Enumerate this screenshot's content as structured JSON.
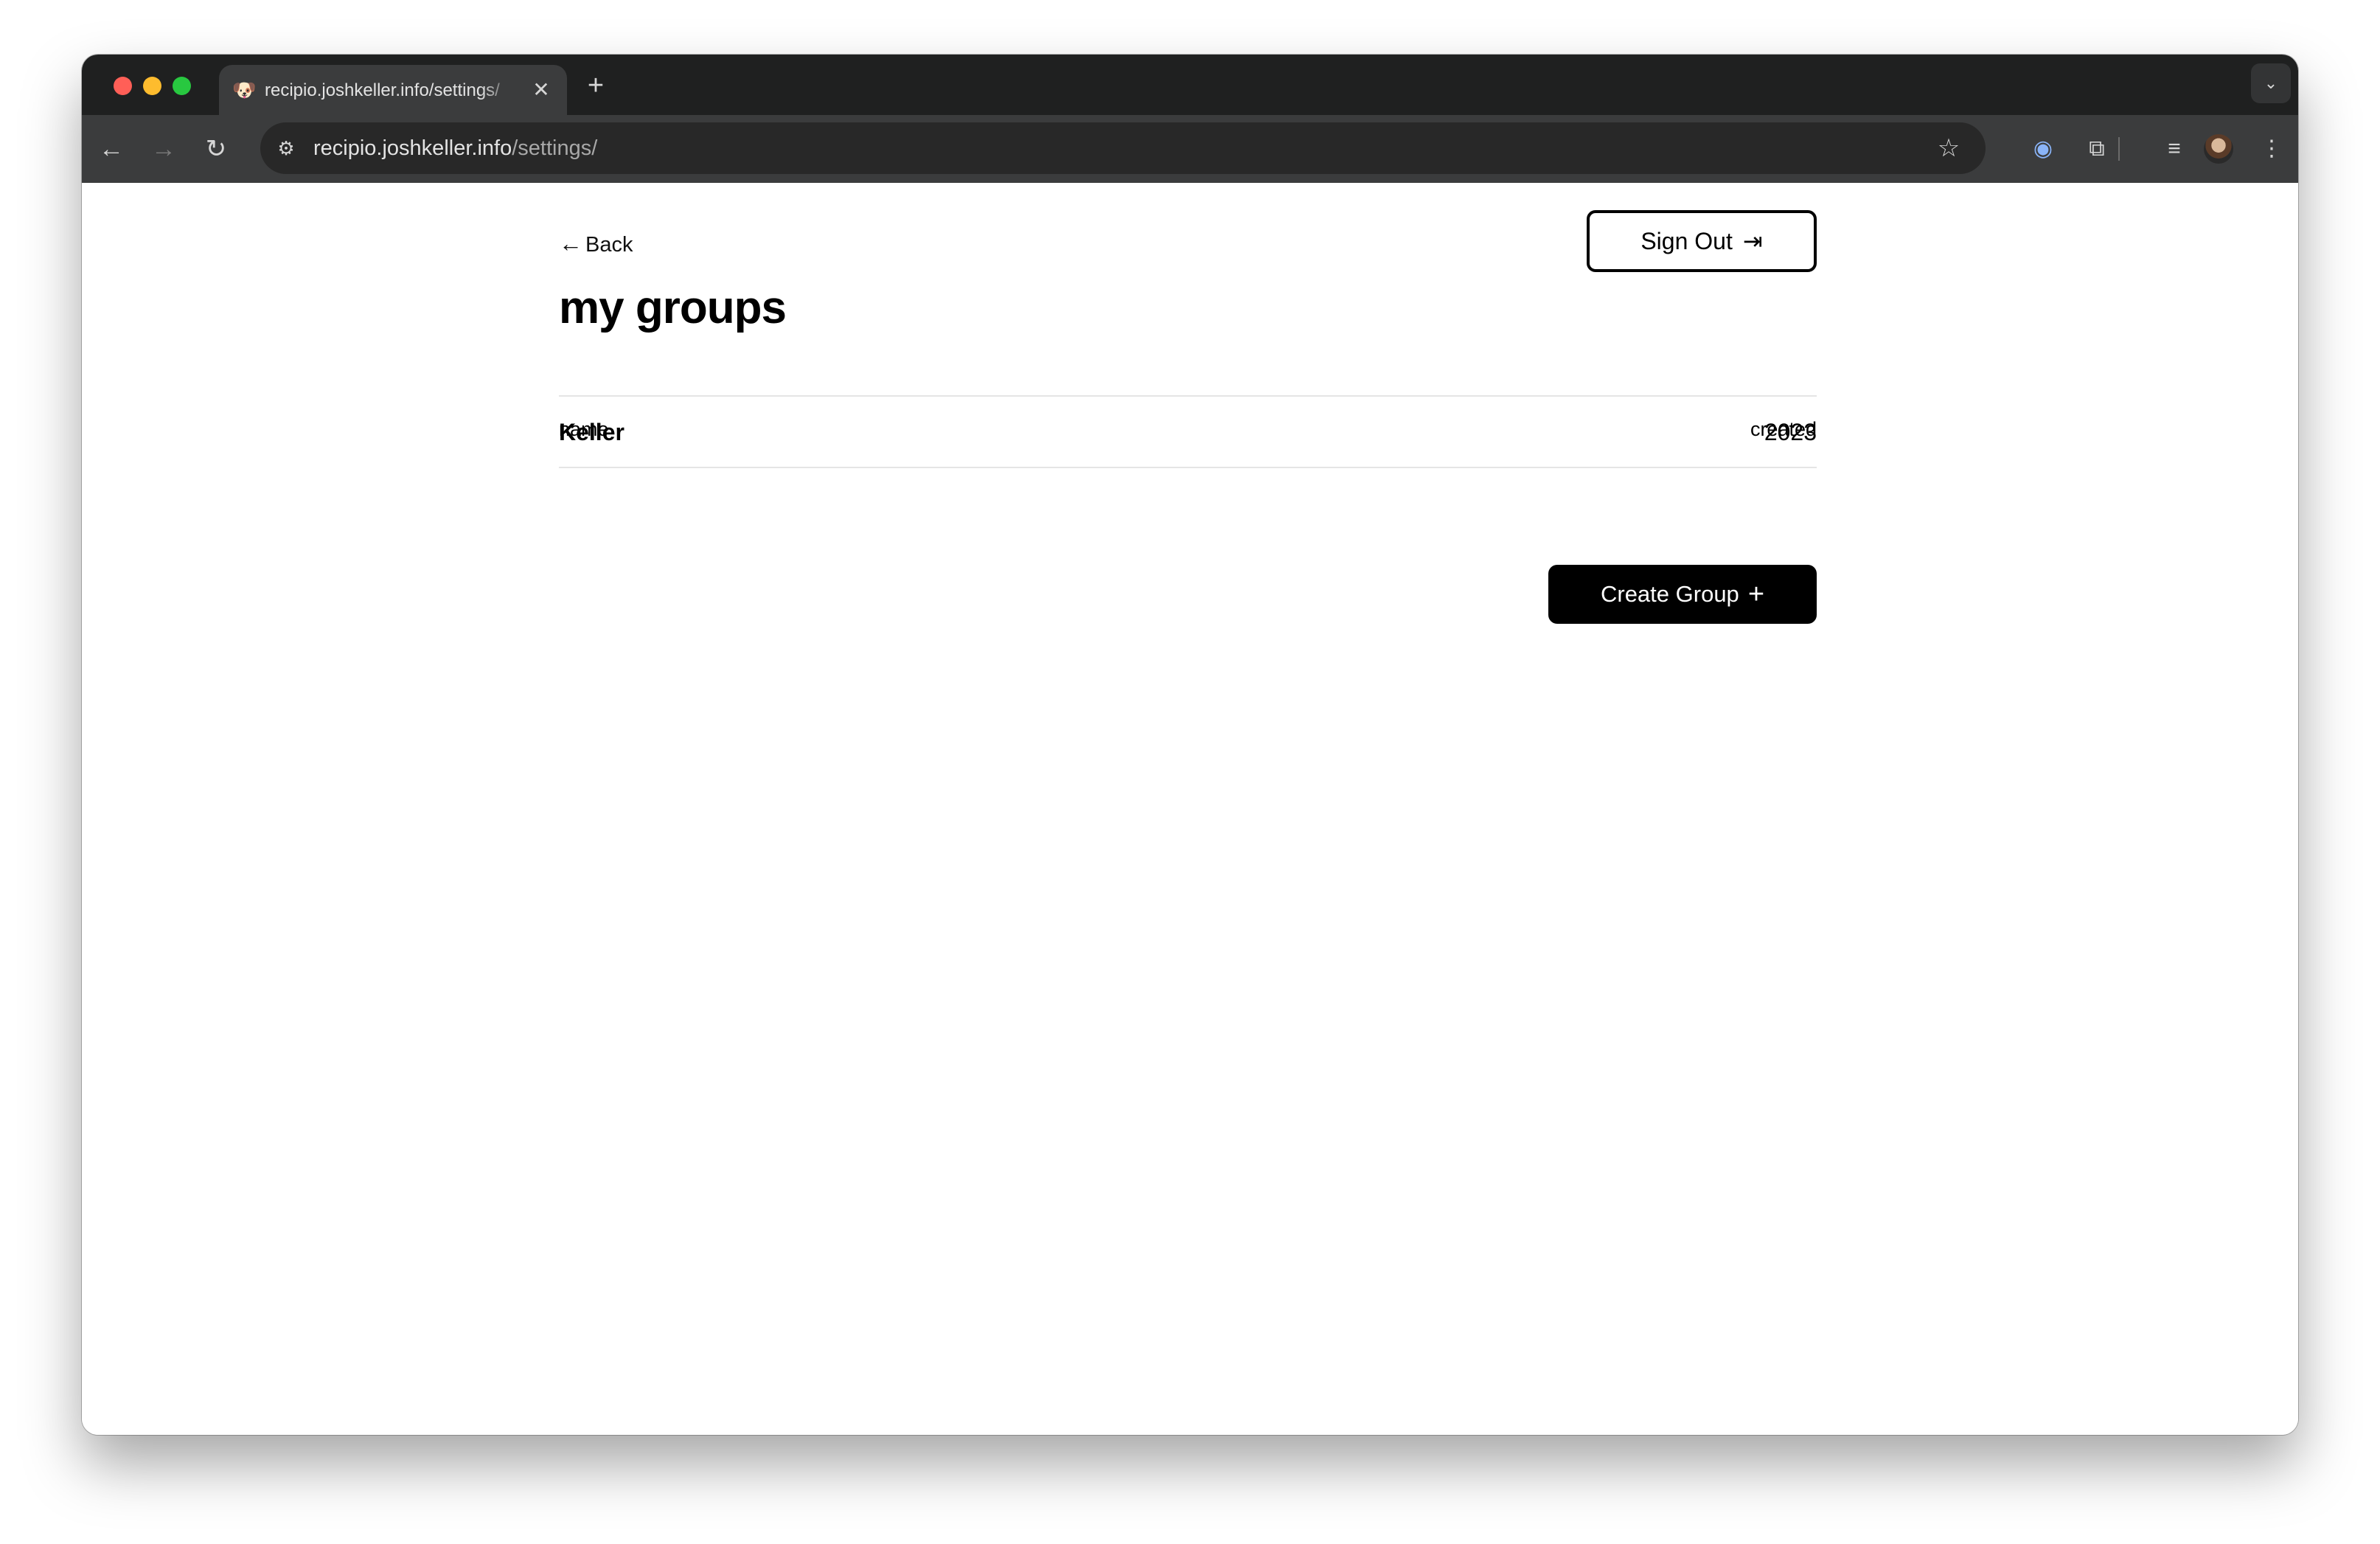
{
  "browser": {
    "tab": {
      "title": "recipio.joshkeller.info/settings/",
      "favicon": "🐶",
      "close_glyph": "✕"
    },
    "new_tab_glyph": "+",
    "tab_search_glyph": "⌄",
    "nav": {
      "back_glyph": "←",
      "forward_glyph": "→",
      "reload_glyph": "↻"
    },
    "omnibox": {
      "site_info_glyph": "⚙",
      "url_host": "recipio.joshkeller.info",
      "url_path": "/settings/",
      "bookmark_glyph": "☆"
    },
    "extensions": {
      "password_glyph": "◉",
      "puzzle_glyph": "⧉",
      "media_glyph": "≡",
      "menu_glyph": "⋮"
    }
  },
  "page": {
    "back_label": "Back",
    "back_glyph": "←",
    "sign_out_label": "Sign Out",
    "sign_out_glyph": "⇥",
    "title": "my groups",
    "table": {
      "columns": [
        "name",
        "created"
      ],
      "rows": [
        {
          "name": "Keller",
          "created": "2023"
        }
      ]
    },
    "create_group_label": "Create Group",
    "create_group_glyph": "+"
  }
}
